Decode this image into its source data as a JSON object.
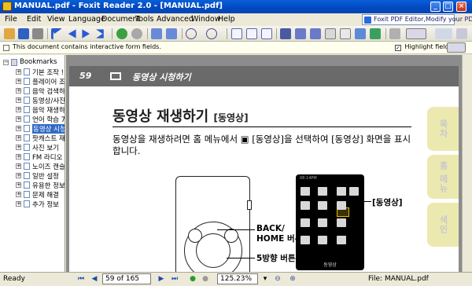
{
  "window": {
    "title": "MANUAL.pdf - Foxit Reader 2.0 - [MANUAL.pdf]",
    "minimize": "_",
    "maximize": "□",
    "close": "×"
  },
  "menu": [
    "File",
    "Edit",
    "View",
    "Language",
    "Document",
    "Tools",
    "Advanced",
    "Window",
    "Help"
  ],
  "promo": "Foxit PDF Editor,Modify your PDF!",
  "formbar": {
    "message": "This document contains interactive form fields.",
    "highlight_label": "Highlight fields",
    "highlight_checked": "✓"
  },
  "bookmarks": {
    "root": "Bookmarks",
    "items": [
      "기본 조작 !",
      "플레이어 조",
      "음악 검색하",
      "동영상/사진",
      "음악 재생하",
      "언어 학습 7",
      "동영상 시청",
      "팟캐스트 재",
      "사진 보기",
      "FM 라디오 !",
      "노이즈 캔슬",
      "일반 설정",
      "유용한 정보",
      "문제 해결",
      "추가 정보"
    ],
    "selected_index": 6
  },
  "page": {
    "number": "59",
    "header_title": "동영상 시청하기",
    "heading": "동영상 재생하기",
    "heading_sub": "[동영상]",
    "body": "동영상을 재생하려면 홈 메뉴에서 ▣ [동영상]을 선택하여 [동영상] 화면을 표시합니다.",
    "label_back_line1": "BACK/",
    "label_back_line2": "HOME 버튼",
    "label_5way": "5방향 버튼",
    "label_movie": "[동영상]",
    "device_status": "08:14PM",
    "device_caption": "동영상",
    "side_tabs": [
      "목차",
      "홈 메뉴",
      "색인"
    ]
  },
  "status": {
    "ready": "Ready",
    "page_indicator": "59 of 165",
    "zoom": "125.23%",
    "file": "File: MANUAL.pdf"
  }
}
